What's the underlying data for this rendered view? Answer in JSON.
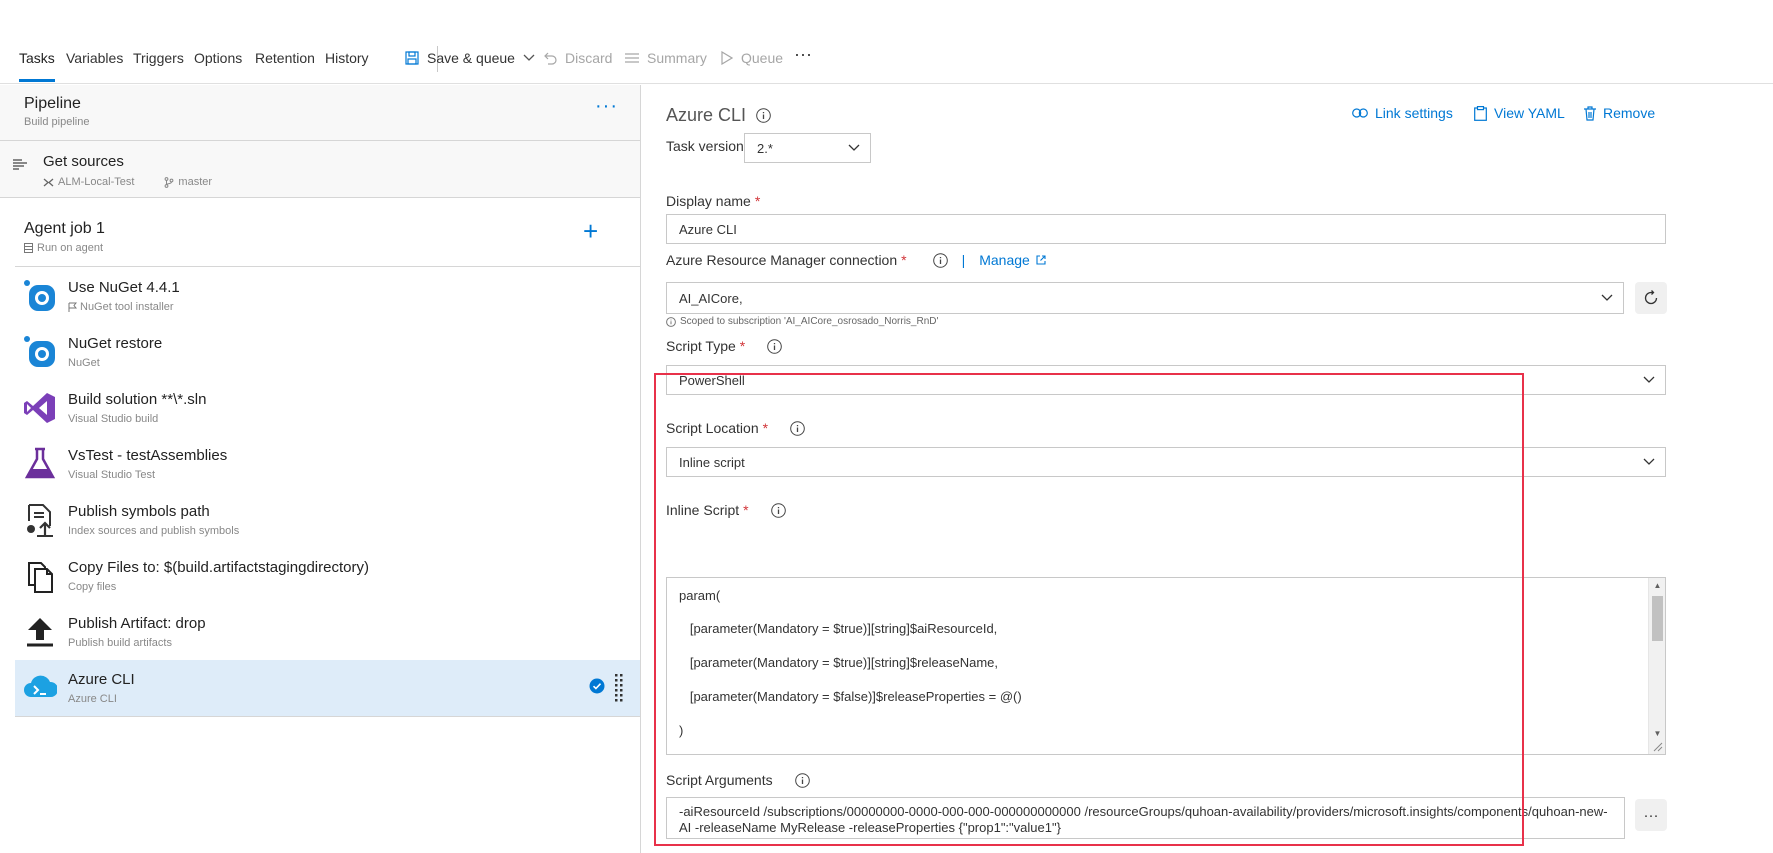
{
  "topnav": {
    "tabs": [
      {
        "label": "Tasks",
        "active": true
      },
      {
        "label": "Variables"
      },
      {
        "label": "Triggers"
      },
      {
        "label": "Options"
      },
      {
        "label": "Retention"
      },
      {
        "label": "History"
      }
    ],
    "save_queue": "Save & queue",
    "discard": "Discard",
    "summary": "Summary",
    "queue": "Queue",
    "more": "···"
  },
  "pipeline": {
    "title": "Pipeline",
    "subtitle": "Build pipeline",
    "more": "···"
  },
  "get_sources": {
    "title": "Get sources",
    "repo": "ALM-Local-Test",
    "branch": "master"
  },
  "agent_job": {
    "title": "Agent job 1",
    "subtitle": "Run on agent",
    "add": "+"
  },
  "tasks": [
    {
      "title": "Use NuGet 4.4.1",
      "subtitle": "NuGet tool installer",
      "icon": "nuget-icon"
    },
    {
      "title": "NuGet restore",
      "subtitle": "NuGet",
      "icon": "nuget-icon"
    },
    {
      "title": "Build solution **\\*.sln",
      "subtitle": "Visual Studio build",
      "icon": "visual-studio-icon"
    },
    {
      "title": "VsTest - testAssemblies",
      "subtitle": "Visual Studio Test",
      "icon": "flask-icon"
    },
    {
      "title": "Publish symbols path",
      "subtitle": "Index sources and publish symbols",
      "icon": "publish-symbols-icon"
    },
    {
      "title": "Copy Files to: $(build.artifactstagingdirectory)",
      "subtitle": "Copy files",
      "icon": "copy-files-icon"
    },
    {
      "title": "Publish Artifact: drop",
      "subtitle": "Publish build artifacts",
      "icon": "upload-icon"
    },
    {
      "title": "Azure CLI",
      "subtitle": "Azure CLI",
      "icon": "azure-cli-icon",
      "selected": true
    }
  ],
  "detail": {
    "title": "Azure CLI",
    "link_settings": "Link settings",
    "view_yaml": "View YAML",
    "remove": "Remove",
    "task_version_label": "Task version",
    "task_version_value": "2.*",
    "display_name_label": "Display name",
    "display_name_value": "Azure CLI",
    "arm_label": "Azure Resource Manager connection",
    "manage": "Manage",
    "arm_value": "AI_AICore,",
    "scope_note": "Scoped to subscription 'AI_AICore_osrosado_Norris_RnD'",
    "script_type_label": "Script Type",
    "script_type_value": "PowerShell",
    "script_location_label": "Script Location",
    "script_location_value": "Inline script",
    "inline_script_label": "Inline Script",
    "inline_script_lines": [
      "param(",
      "   [parameter(Mandatory = $true)][string]$aiResourceId,",
      "   [parameter(Mandatory = $true)][string]$releaseName,",
      "   [parameter(Mandatory = $false)]$releaseProperties = @()",
      ")"
    ],
    "script_args_label": "Script Arguments",
    "script_args_value": "-aiResourceId /subscriptions/00000000-0000-000-000-000000000000       /resourceGroups/quhoan-availability/providers/microsoft.insights/components/quhoan-new-AI -releaseName MyRelease -releaseProperties  {\"prop1\":\"value1\"}",
    "args_more": "···"
  },
  "colors": {
    "accent": "#0078d4",
    "selected_bg": "#deecf9",
    "highlight_border": "#e8314a",
    "required": "#d13438"
  }
}
